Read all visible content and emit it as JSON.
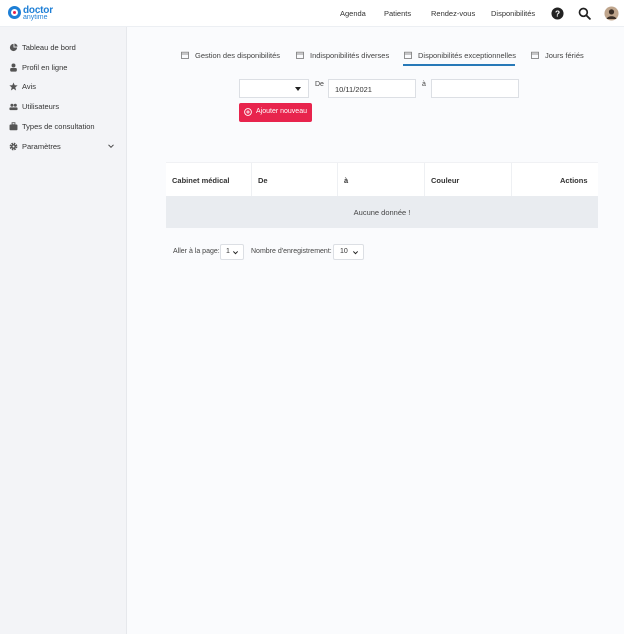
{
  "header": {
    "logo_line1": "doctor",
    "logo_line2": "anytime",
    "nav": [
      "Agenda",
      "Patients",
      "Rendez-vous",
      "Disponibilités"
    ],
    "icons": [
      "help-icon",
      "search-icon",
      "user-avatar"
    ]
  },
  "sidebar": {
    "items": [
      {
        "label": "Tableau de bord",
        "icon": "dashboard-icon"
      },
      {
        "label": "Profil en ligne",
        "icon": "person-icon"
      },
      {
        "label": "Avis",
        "icon": "star-icon"
      },
      {
        "label": "Utilisateurs",
        "icon": "users-icon"
      },
      {
        "label": "Types de consultation",
        "icon": "briefcase-icon"
      },
      {
        "label": "Paramètres",
        "icon": "gear-icon"
      }
    ]
  },
  "tabs": [
    {
      "label": "Gestion des disponibilités"
    },
    {
      "label": "Indisponibilités diverses"
    },
    {
      "label": "Disponibilités exceptionnelles",
      "active": true
    },
    {
      "label": "Jours fériés"
    }
  ],
  "filters": {
    "select_value": "",
    "from_label": "De",
    "from_value": "10/11/2021",
    "to_label": "à",
    "to_value": "",
    "add_button": "Ajouter nouveau"
  },
  "table": {
    "columns": [
      "Cabinet médical",
      "De",
      "à",
      "Couleur",
      "Actions"
    ],
    "empty_message": "Aucune donnée !"
  },
  "pagination": {
    "page_label": "Aller à la page:",
    "page_value": "1",
    "records_label": "Nombre d'enregistrement:",
    "records_value": "10"
  },
  "colors": {
    "brand_blue": "#1e7fd6",
    "accent_red": "#e8244d",
    "active_tab": "#2779b8"
  }
}
